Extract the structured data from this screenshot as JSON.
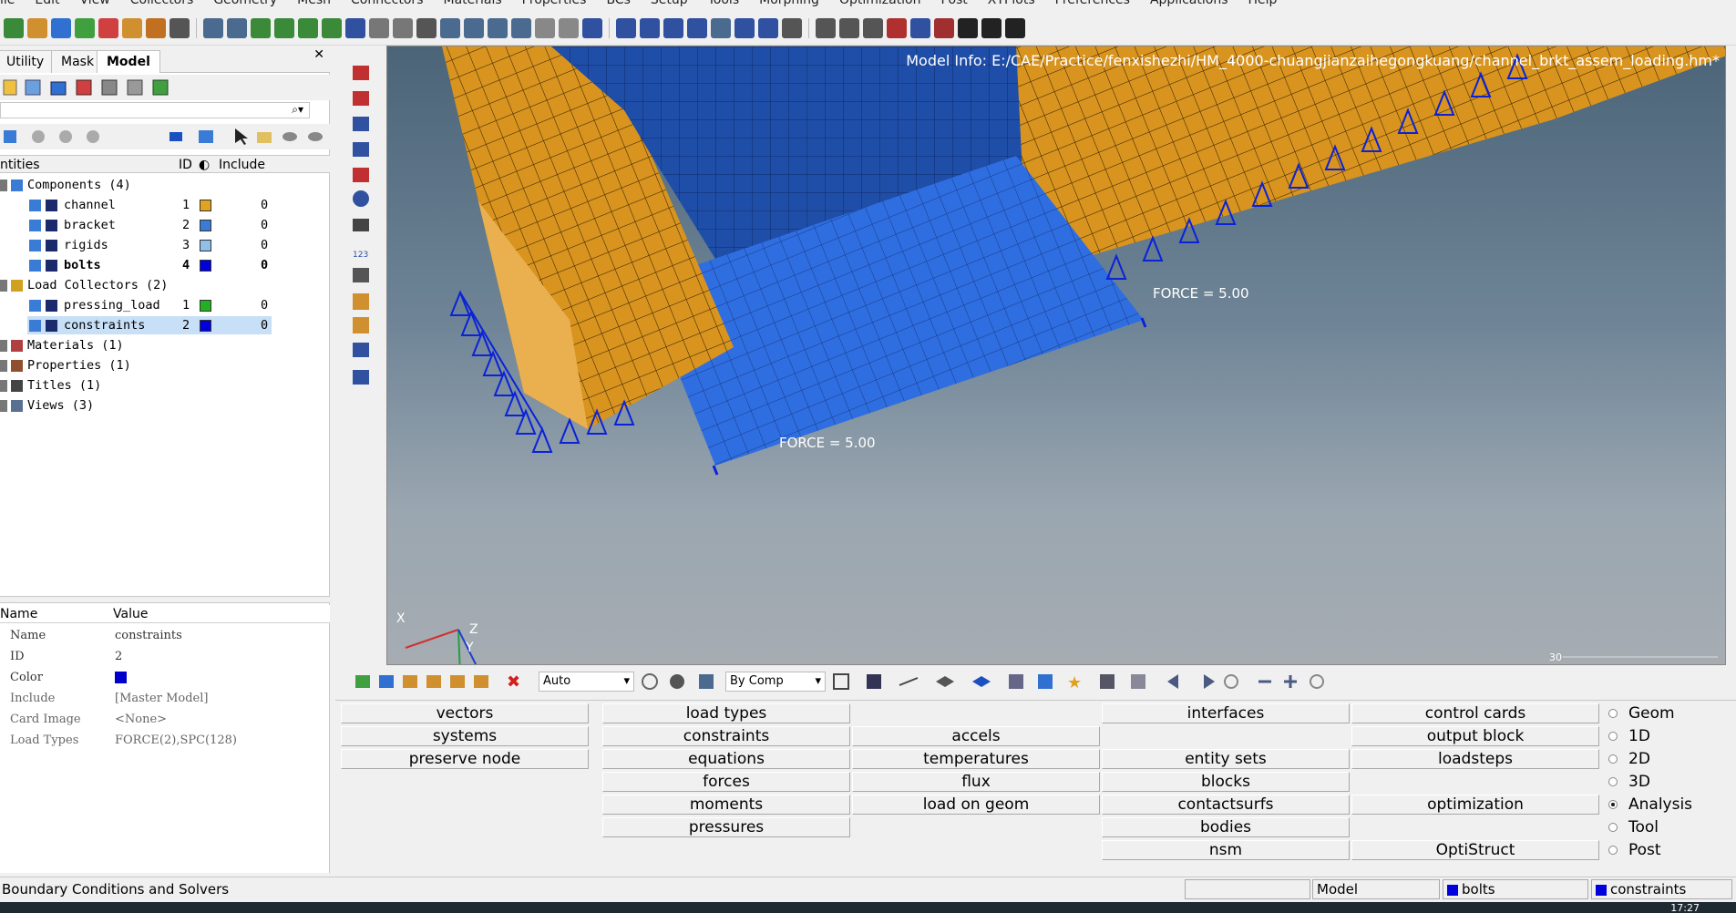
{
  "menu": [
    "ile",
    "Edit",
    "View",
    "Collectors",
    "Geometry",
    "Mesh",
    "Connectors",
    "Materials",
    "Properties",
    "BCs",
    "Setup",
    "Tools",
    "Morphing",
    "Optimization",
    "Post",
    "XYPlots",
    "Preferences",
    "Applications",
    "Help"
  ],
  "tabs": {
    "utility": "Utility",
    "mask": "Mask",
    "model": "Model"
  },
  "tree_header": {
    "entities": "ntities",
    "id": "ID",
    "include": "Include"
  },
  "tree": {
    "components": "Components (4)",
    "channel": {
      "label": "channel",
      "id": "1",
      "include": "0",
      "color": "#e5a21e"
    },
    "bracket": {
      "label": "bracket",
      "id": "2",
      "include": "0",
      "color": "#3a7bd5"
    },
    "rigids": {
      "label": "rigids",
      "id": "3",
      "include": "0",
      "color": "#8fc0ea"
    },
    "bolts": {
      "label": "bolts",
      "id": "4",
      "include": "0",
      "color": "#0000dd"
    },
    "load_collectors": "Load Collectors (2)",
    "pressing_load": {
      "label": "pressing_load",
      "id": "1",
      "include": "0",
      "color": "#22b022"
    },
    "constraints": {
      "label": "constraints",
      "id": "2",
      "include": "0",
      "color": "#0000dd"
    },
    "materials": "Materials (1)",
    "properties": "Properties (1)",
    "titles": "Titles (1)",
    "views": "Views (3)"
  },
  "props_header": {
    "name": "Name",
    "value": "Value"
  },
  "props": {
    "name": {
      "k": "Name",
      "v": "constraints"
    },
    "id": {
      "k": "ID",
      "v": "2"
    },
    "color": {
      "k": "Color"
    },
    "include": {
      "k": "Include",
      "v": "[Master Model]"
    },
    "card_image": {
      "k": "Card Image",
      "v": "<None>"
    },
    "load_types": {
      "k": "Load Types",
      "v": "FORCE(2),SPC(128)"
    }
  },
  "viewport": {
    "model_info": "Model Info: E:/CAE/Practice/fenxishezhi/HM_4000-chuangjianzaihegongkuang/channel_brkt_assem_loading.hm*",
    "force1": "FORCE = 5.00",
    "force2": "FORCE = 5.00",
    "axis_x": "X",
    "axis_y": "Y",
    "axis_z": "Z",
    "scale": "30"
  },
  "vp_toolbar": {
    "auto": "Auto",
    "by_comp": "By Comp"
  },
  "panel": {
    "col1": [
      "vectors",
      "systems",
      "preserve node"
    ],
    "col2": [
      "load types",
      "constraints",
      "equations",
      "forces",
      "moments",
      "pressures"
    ],
    "col3": [
      "accels",
      "temperatures",
      "flux",
      "load on geom"
    ],
    "col4": [
      "interfaces",
      "entity sets",
      "blocks",
      "contactsurfs",
      "bodies",
      "nsm"
    ],
    "col5": [
      "control cards",
      "output block",
      "loadsteps",
      "optimization",
      "OptiStruct"
    ],
    "radios": [
      "Geom",
      "1D",
      "2D",
      "3D",
      "Analysis",
      "Tool",
      "Post"
    ],
    "selected_radio": "Analysis"
  },
  "status": {
    "text": "Boundary Conditions and Solvers",
    "model": "Model",
    "comp": "bolts",
    "lc": "constraints"
  },
  "clock": "17:27"
}
